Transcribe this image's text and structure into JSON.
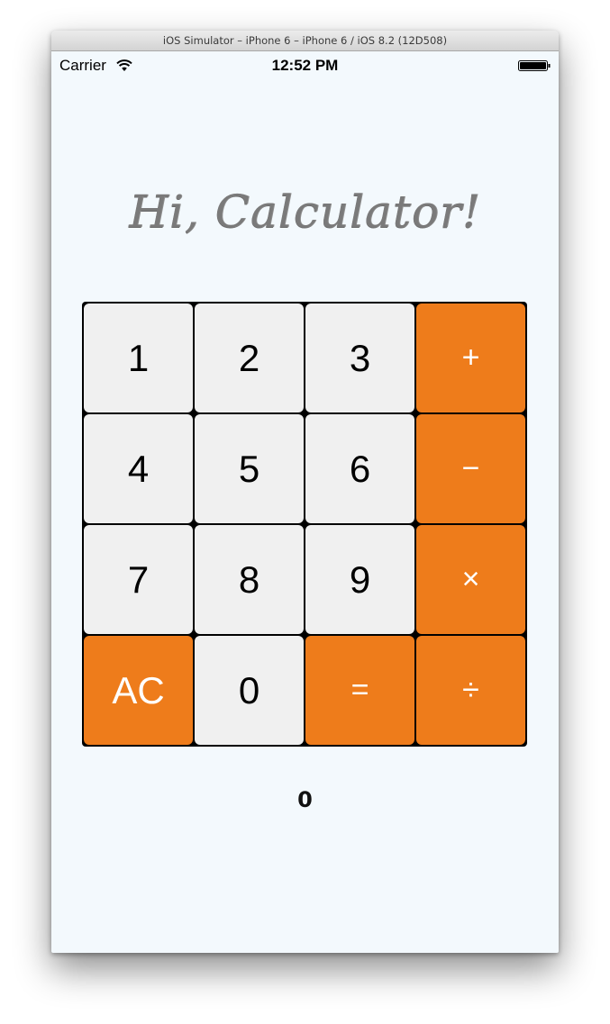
{
  "window": {
    "title": "iOS Simulator – iPhone 6 – iPhone 6 / iOS 8.2 (12D508)"
  },
  "status_bar": {
    "carrier": "Carrier",
    "time": "12:52 PM",
    "wifi_icon": "wifi-icon",
    "battery_icon": "battery-icon"
  },
  "app": {
    "headline": "Hi, Calculator!",
    "display_value": "0",
    "colors": {
      "background": "#f3f9fd",
      "number_key": "#f0f0f0",
      "operator_key": "#ee7c1b",
      "grid_lines": "#000000",
      "headline": "#7a7a7a"
    },
    "keys": {
      "k1": "1",
      "k2": "2",
      "k3": "3",
      "plus": "+",
      "k4": "4",
      "k5": "5",
      "k6": "6",
      "minus": "−",
      "k7": "7",
      "k8": "8",
      "k9": "9",
      "multiply": "×",
      "clear": "AC",
      "k0": "0",
      "equals": "=",
      "divide": "÷"
    }
  }
}
